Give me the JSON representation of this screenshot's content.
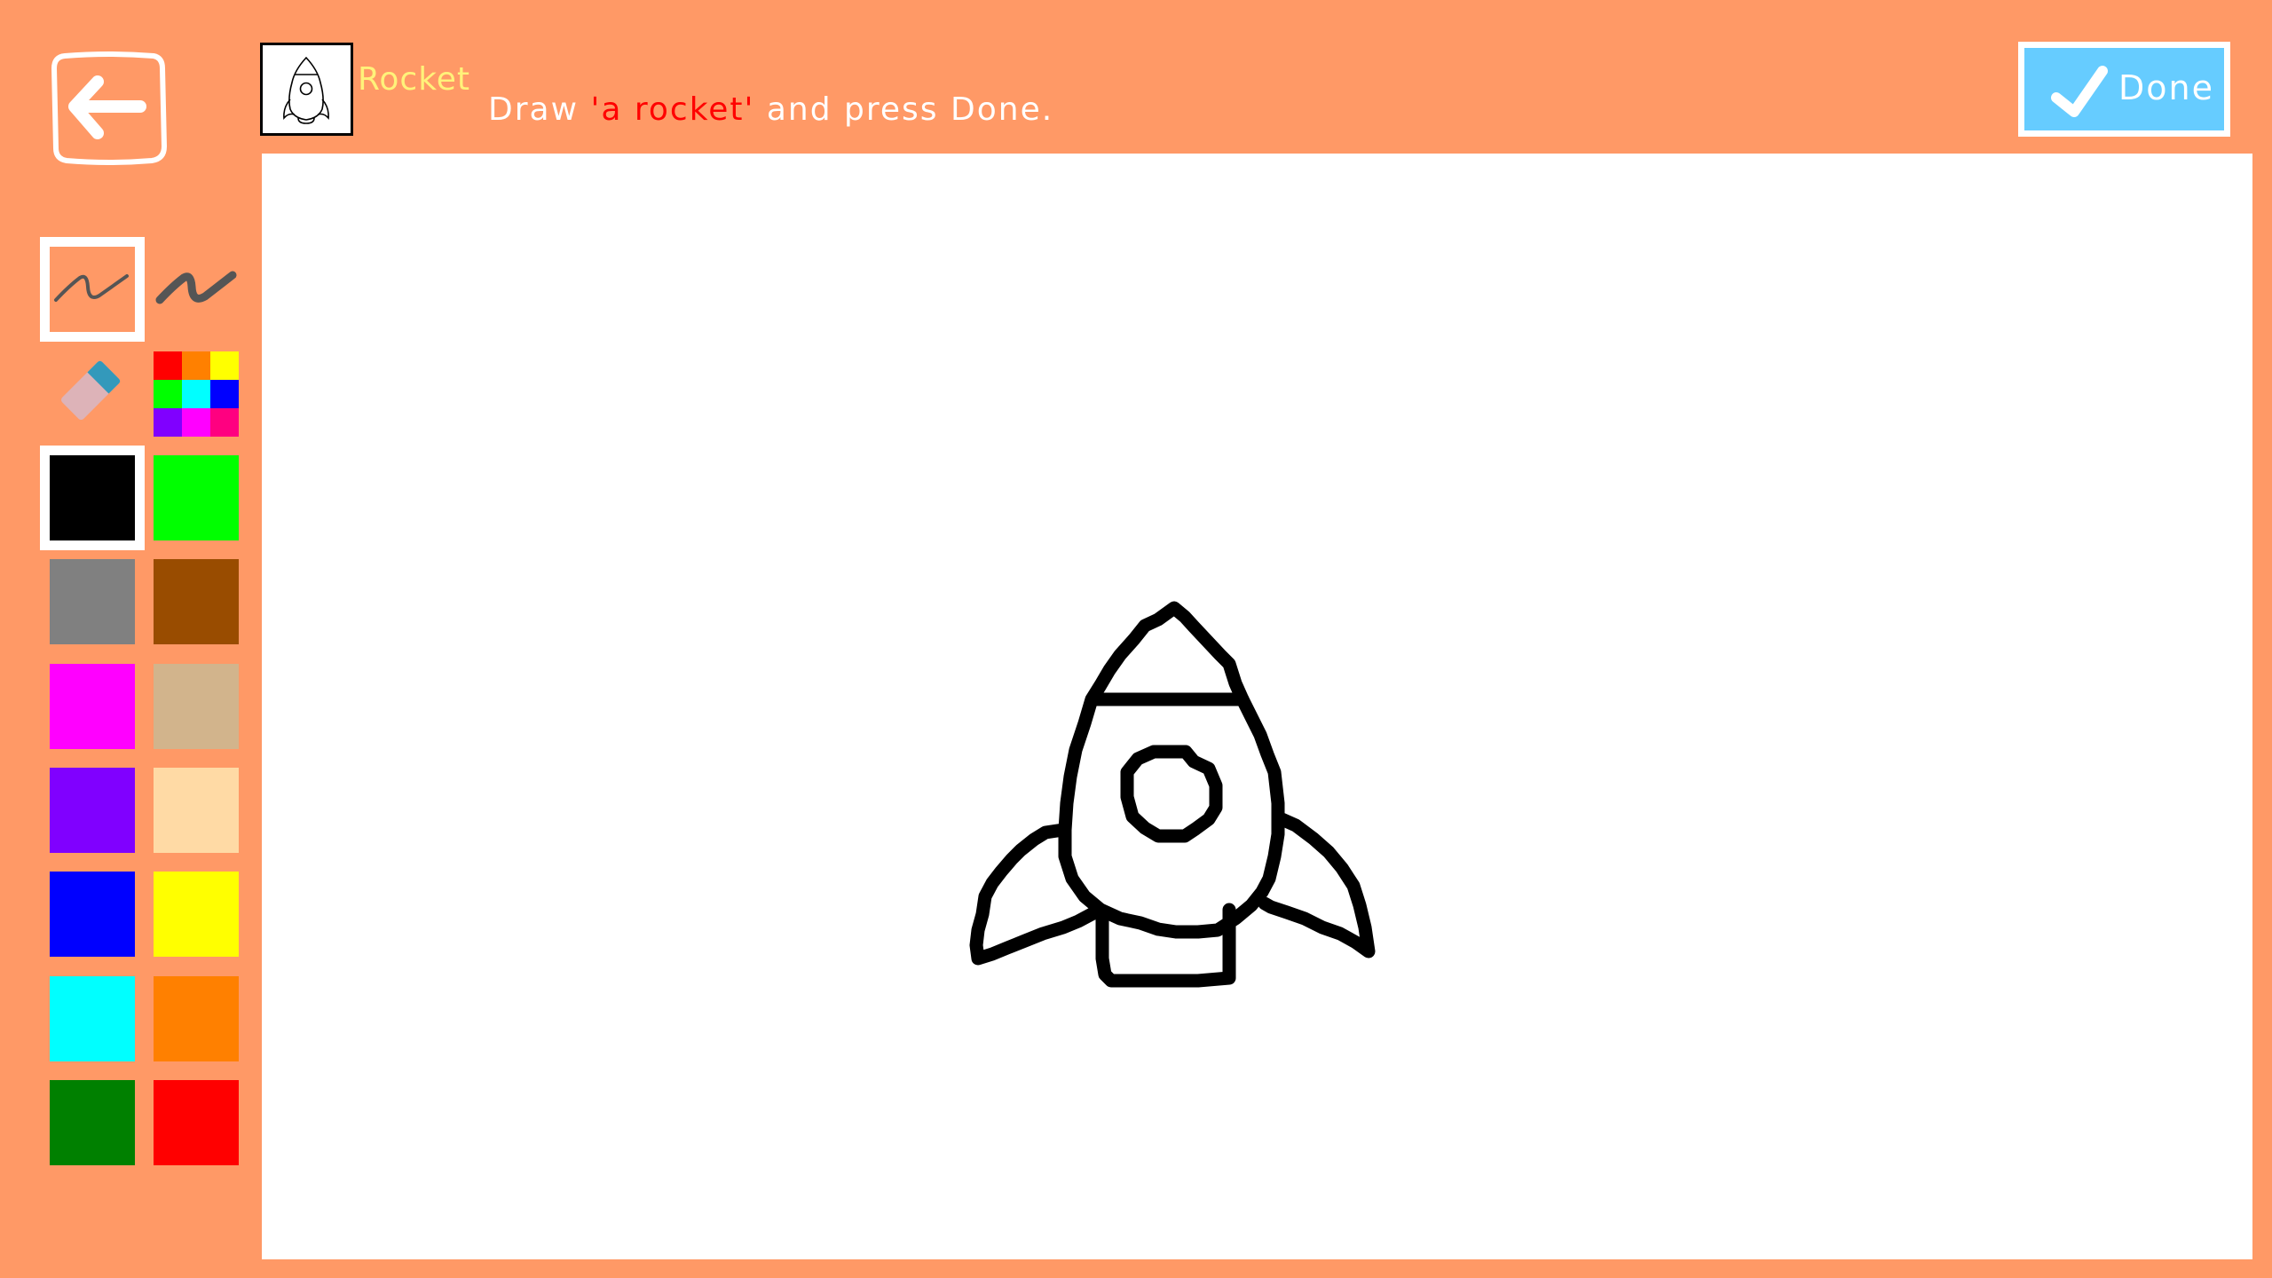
{
  "header": {
    "back_icon": "arrow-left-icon",
    "subject_label": "Rocket",
    "instruction": {
      "prefix": "Draw ",
      "quoted": "'a rocket'",
      "suffix": " and press Done."
    },
    "colors": {
      "subject": "#FFF27A",
      "instruction": "#FFFFFF",
      "highlight": "#FF0000",
      "background": "#FF9966"
    }
  },
  "done_button": {
    "label": "Done",
    "icon": "checkmark-icon",
    "color": "#66CCFF"
  },
  "tools": [
    {
      "name": "thin-pen",
      "icon": "thin-pen-icon",
      "selected": true
    },
    {
      "name": "thick-pen",
      "icon": "thick-pen-icon",
      "selected": false
    },
    {
      "name": "eraser",
      "icon": "eraser-icon",
      "selected": false
    },
    {
      "name": "color-picker",
      "icon": "color-grid-icon",
      "selected": false
    }
  ],
  "color_picker_grid": [
    "#FF0000",
    "#FF8000",
    "#FFFF00",
    "#00FF00",
    "#00FFFF",
    "#0000FF",
    "#8000FF",
    "#FF00FF",
    "#FF0080"
  ],
  "palette": [
    {
      "name": "black",
      "hex": "#000000",
      "selected": true
    },
    {
      "name": "lime",
      "hex": "#00FF00",
      "selected": false
    },
    {
      "name": "gray",
      "hex": "#808080",
      "selected": false
    },
    {
      "name": "brown",
      "hex": "#994C00",
      "selected": false
    },
    {
      "name": "magenta",
      "hex": "#FF00FF",
      "selected": false
    },
    {
      "name": "tan",
      "hex": "#D2B48C",
      "selected": false
    },
    {
      "name": "purple",
      "hex": "#8000FF",
      "selected": false
    },
    {
      "name": "peach",
      "hex": "#FFDAA5",
      "selected": false
    },
    {
      "name": "blue",
      "hex": "#0000FF",
      "selected": false
    },
    {
      "name": "yellow",
      "hex": "#FFFF00",
      "selected": false
    },
    {
      "name": "cyan",
      "hex": "#00FFFF",
      "selected": false
    },
    {
      "name": "orange",
      "hex": "#FF8000",
      "selected": false
    },
    {
      "name": "green",
      "hex": "#008000",
      "selected": false
    },
    {
      "name": "red",
      "hex": "#FF0000",
      "selected": false
    }
  ],
  "canvas": {
    "drawing_subject": "rocket",
    "stroke_color": "#000000"
  }
}
